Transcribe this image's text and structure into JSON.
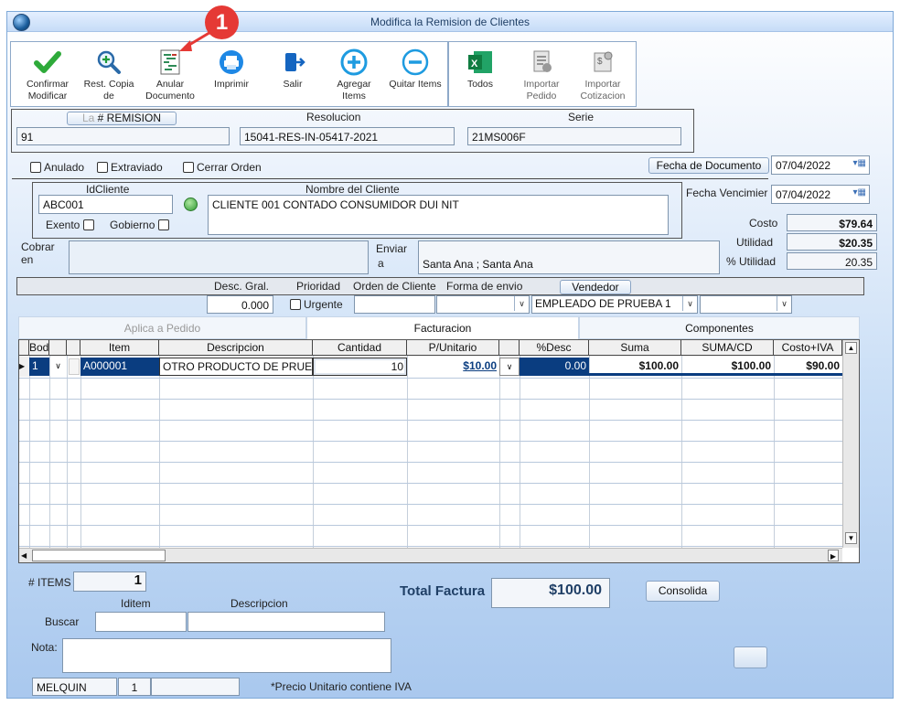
{
  "window": {
    "title": "Modifica la Remision de Clientes"
  },
  "callout": {
    "number": "1"
  },
  "toolbar": [
    {
      "label": "Confirmar Modificar",
      "icon": "check-icon",
      "enabled": true
    },
    {
      "label": "Rest. Copia de",
      "icon": "zoom-plus-icon",
      "enabled": true
    },
    {
      "label": "Anular Documento",
      "icon": "document-gantt-icon",
      "enabled": true
    },
    {
      "label": "Imprimir",
      "icon": "printer-icon",
      "enabled": true
    },
    {
      "label": "Salir",
      "icon": "exit-door-icon",
      "enabled": true
    },
    {
      "label": "Agregar Items",
      "icon": "plus-circle-icon",
      "enabled": true
    },
    {
      "label": "Quitar Items",
      "icon": "minus-circle-icon",
      "enabled": true
    },
    {
      "label": "Todos",
      "icon": "excel-icon",
      "enabled": true
    },
    {
      "label": "Importar Pedido",
      "icon": "import-order-icon",
      "enabled": false
    },
    {
      "label": "Importar Cotizacion",
      "icon": "import-quote-icon",
      "enabled": false
    }
  ],
  "header": {
    "remision_label": "# REMISION",
    "remision_prefix": "La",
    "resolucion_label": "Resolucion",
    "serie_label": "Serie",
    "remision": "91",
    "resolucion": "15041-RES-IN-05417-2021",
    "serie": "21MS006F"
  },
  "flags": {
    "anulado": "Anulado",
    "extraviado": "Extraviado",
    "cerrar_orden": "Cerrar Orden"
  },
  "dates": {
    "fecha_documento_label": "Fecha de  Documento",
    "fecha_documento": "07/04/2022",
    "fecha_vencimiento_label": "Fecha Vencimier",
    "fecha_vencimiento": "07/04/2022"
  },
  "client": {
    "idcliente_label": "IdCliente",
    "nombre_label": "Nombre del Cliente",
    "idcliente": "ABC001",
    "nombre": "CLIENTE 001 CONTADO CONSUMIDOR DUI NIT",
    "exento": "Exento",
    "gobierno": "Gobierno"
  },
  "totals_side": {
    "costo_label": "Costo",
    "costo": "$79.64",
    "utilidad_label": "Utilidad",
    "utilidad": "$20.35",
    "putilidad_label": "% Utilidad",
    "putilidad": "20.35"
  },
  "cobrar": {
    "label1": "Cobrar",
    "label2": "en",
    "value": ""
  },
  "enviar": {
    "label1": "Enviar",
    "label2": "a",
    "value": "Santa Ana ; Santa Ana"
  },
  "options": {
    "desc_label": "Desc. Gral.",
    "desc": "0.000",
    "prioridad_label": "Prioridad",
    "urgente": "Urgente",
    "orden_label": "Orden de Cliente",
    "forma_label": "Forma de envio",
    "vendedor_label": "Vendedor",
    "vendedor": "EMPLEADO DE PRUEBA 1"
  },
  "tabs": [
    "Aplica a Pedido",
    "Facturacion",
    "Componentes"
  ],
  "grid": {
    "columns": [
      "Bodega",
      "",
      "",
      "Item",
      "Descripcion",
      "Cantidad",
      "P/Unitario",
      "",
      "%Desc",
      "Suma",
      "SUMA/CD",
      "Costo+IVA"
    ],
    "rows": [
      {
        "bodega": "1",
        "item": "A000001",
        "descripcion": "OTRO PRODUCTO DE PRUE",
        "cantidad": "10",
        "punitario": "$10.00",
        "pdesc": "0.00",
        "suma": "$100.00",
        "sumacd": "$100.00",
        "costoiva": "$90.00"
      }
    ]
  },
  "footer": {
    "items_label": "# ITEMS",
    "items": "1",
    "total_label": "Total Factura",
    "total": "$100.00",
    "consolida": "Consolida",
    "iditem_label": "Iditem",
    "descripcion_label": "Descripcion",
    "buscar_label": "Buscar",
    "nota_label": "Nota:",
    "user": "MELQUIN",
    "user_num": "1",
    "note_iva": "*Precio Unitario contiene IVA"
  }
}
